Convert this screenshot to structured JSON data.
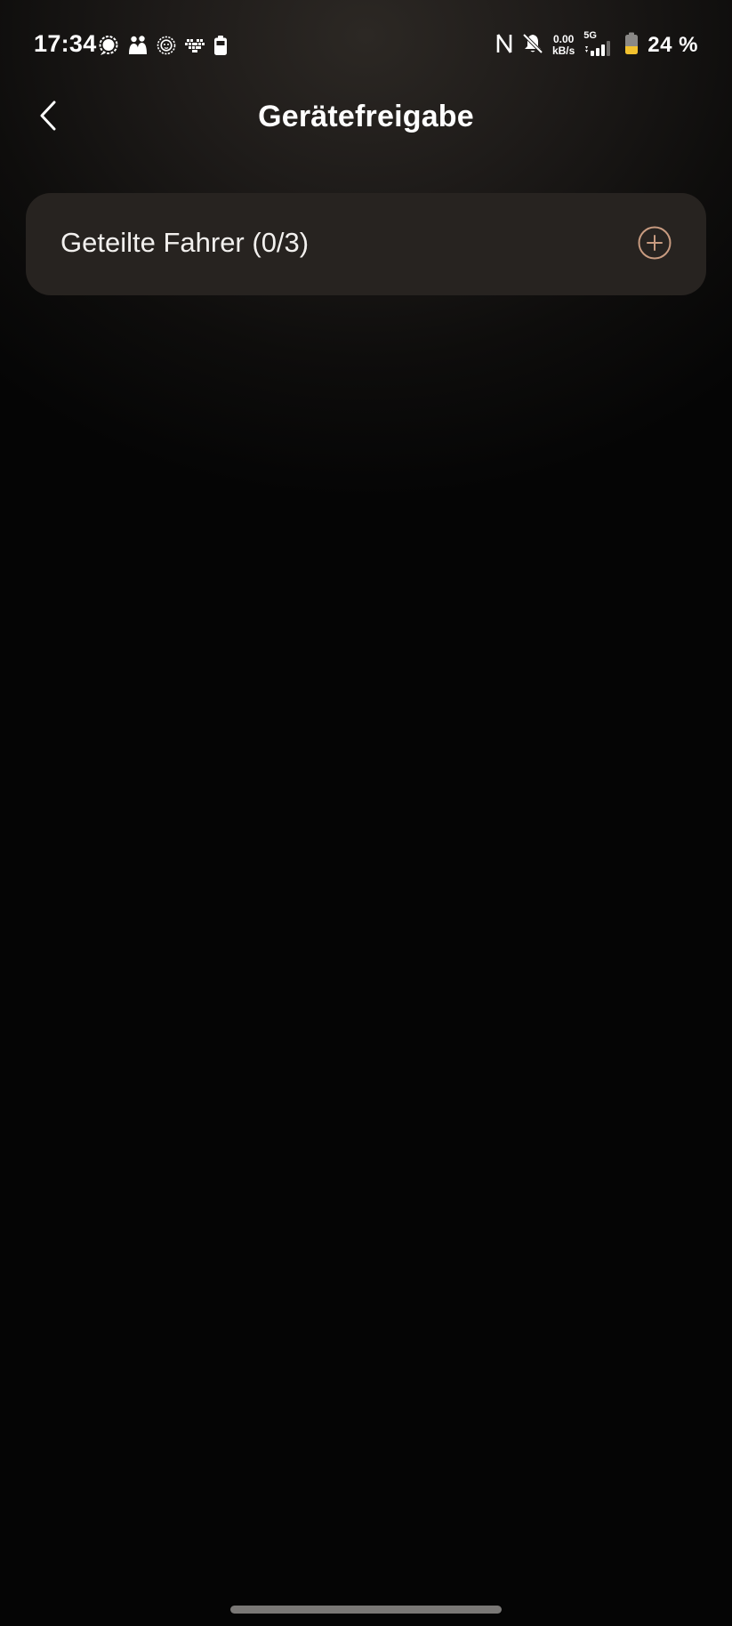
{
  "status_bar": {
    "time": "17:34",
    "left_icons": [
      "chat-bubble-icon",
      "family-icon",
      "lion-app-icon",
      "pixel-heart-icon",
      "battery-saver-icon"
    ],
    "right_icons": [
      "nfc-icon",
      "bell-muted-icon",
      "signal-icon",
      "battery-icon"
    ],
    "net_speed_value": "0.00",
    "net_speed_unit": "kB/s",
    "network_type": "5G",
    "battery_percent": "24 %",
    "battery_level": 0.24,
    "battery_color": "#f2c12e"
  },
  "header": {
    "title": "Gerätefreigabe",
    "back_icon": "chevron-left-icon"
  },
  "shared_drivers": {
    "label": "Geteilte Fahrer (0/3)",
    "add_icon": "plus-circle-icon",
    "accent_color": "#c89b80"
  }
}
